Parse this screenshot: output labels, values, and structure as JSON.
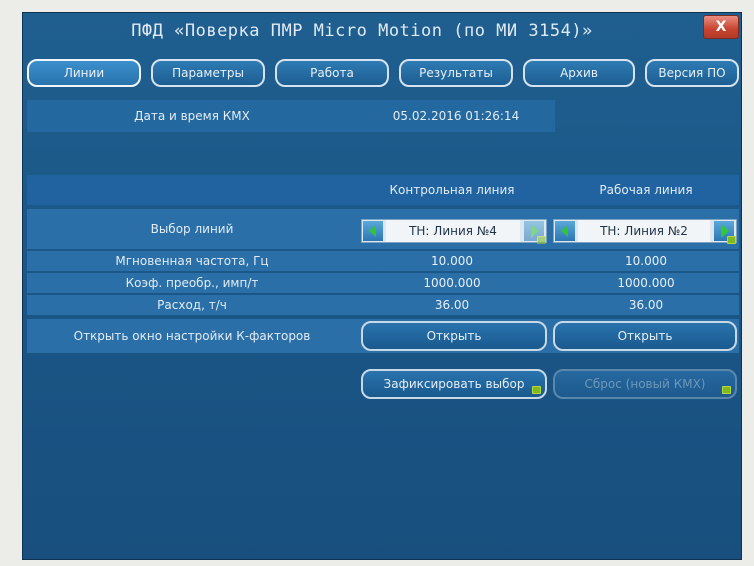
{
  "window": {
    "title": "ПФД «Поверка ПМР Micro Motion (по МИ 3154)»",
    "close_label": "X"
  },
  "tabs": [
    {
      "label": "Линии",
      "active": true
    },
    {
      "label": "Параметры",
      "active": false
    },
    {
      "label": "Работа",
      "active": false
    },
    {
      "label": "Результаты",
      "active": false
    },
    {
      "label": "Архив",
      "active": false
    },
    {
      "label": "Версия ПО",
      "active": false
    }
  ],
  "kmh": {
    "label": "Дата и время КМХ",
    "value": "05.02.2016 01:26:14"
  },
  "columns": {
    "control": "Контрольная линия",
    "working": "Рабочая линия"
  },
  "rows": {
    "line_select": {
      "label": "Выбор линий",
      "control": "ТН: Линия №4",
      "working": "ТН: Линия №2"
    },
    "frequency": {
      "label": "Мгновенная частота, Гц",
      "control": "10.000",
      "working": "10.000"
    },
    "coef": {
      "label": "Коэф. преобр., имп/т",
      "control": "1000.000",
      "working": "1000.000"
    },
    "flow": {
      "label": "Расход, т/ч",
      "control": "36.00",
      "working": "36.00"
    },
    "kfactor": {
      "label": "Открыть окно настройки К-факторов",
      "control_btn": "Открыть",
      "working_btn": "Открыть"
    }
  },
  "actions": {
    "fix_selection": "Зафиксировать выбор",
    "reset": "Сброс (новый КМХ)"
  },
  "colors": {
    "window_bg": "#1b5888",
    "row_bg": "#2a6fa8",
    "accent_green": "#34c23a",
    "close_red": "#c8432f"
  }
}
